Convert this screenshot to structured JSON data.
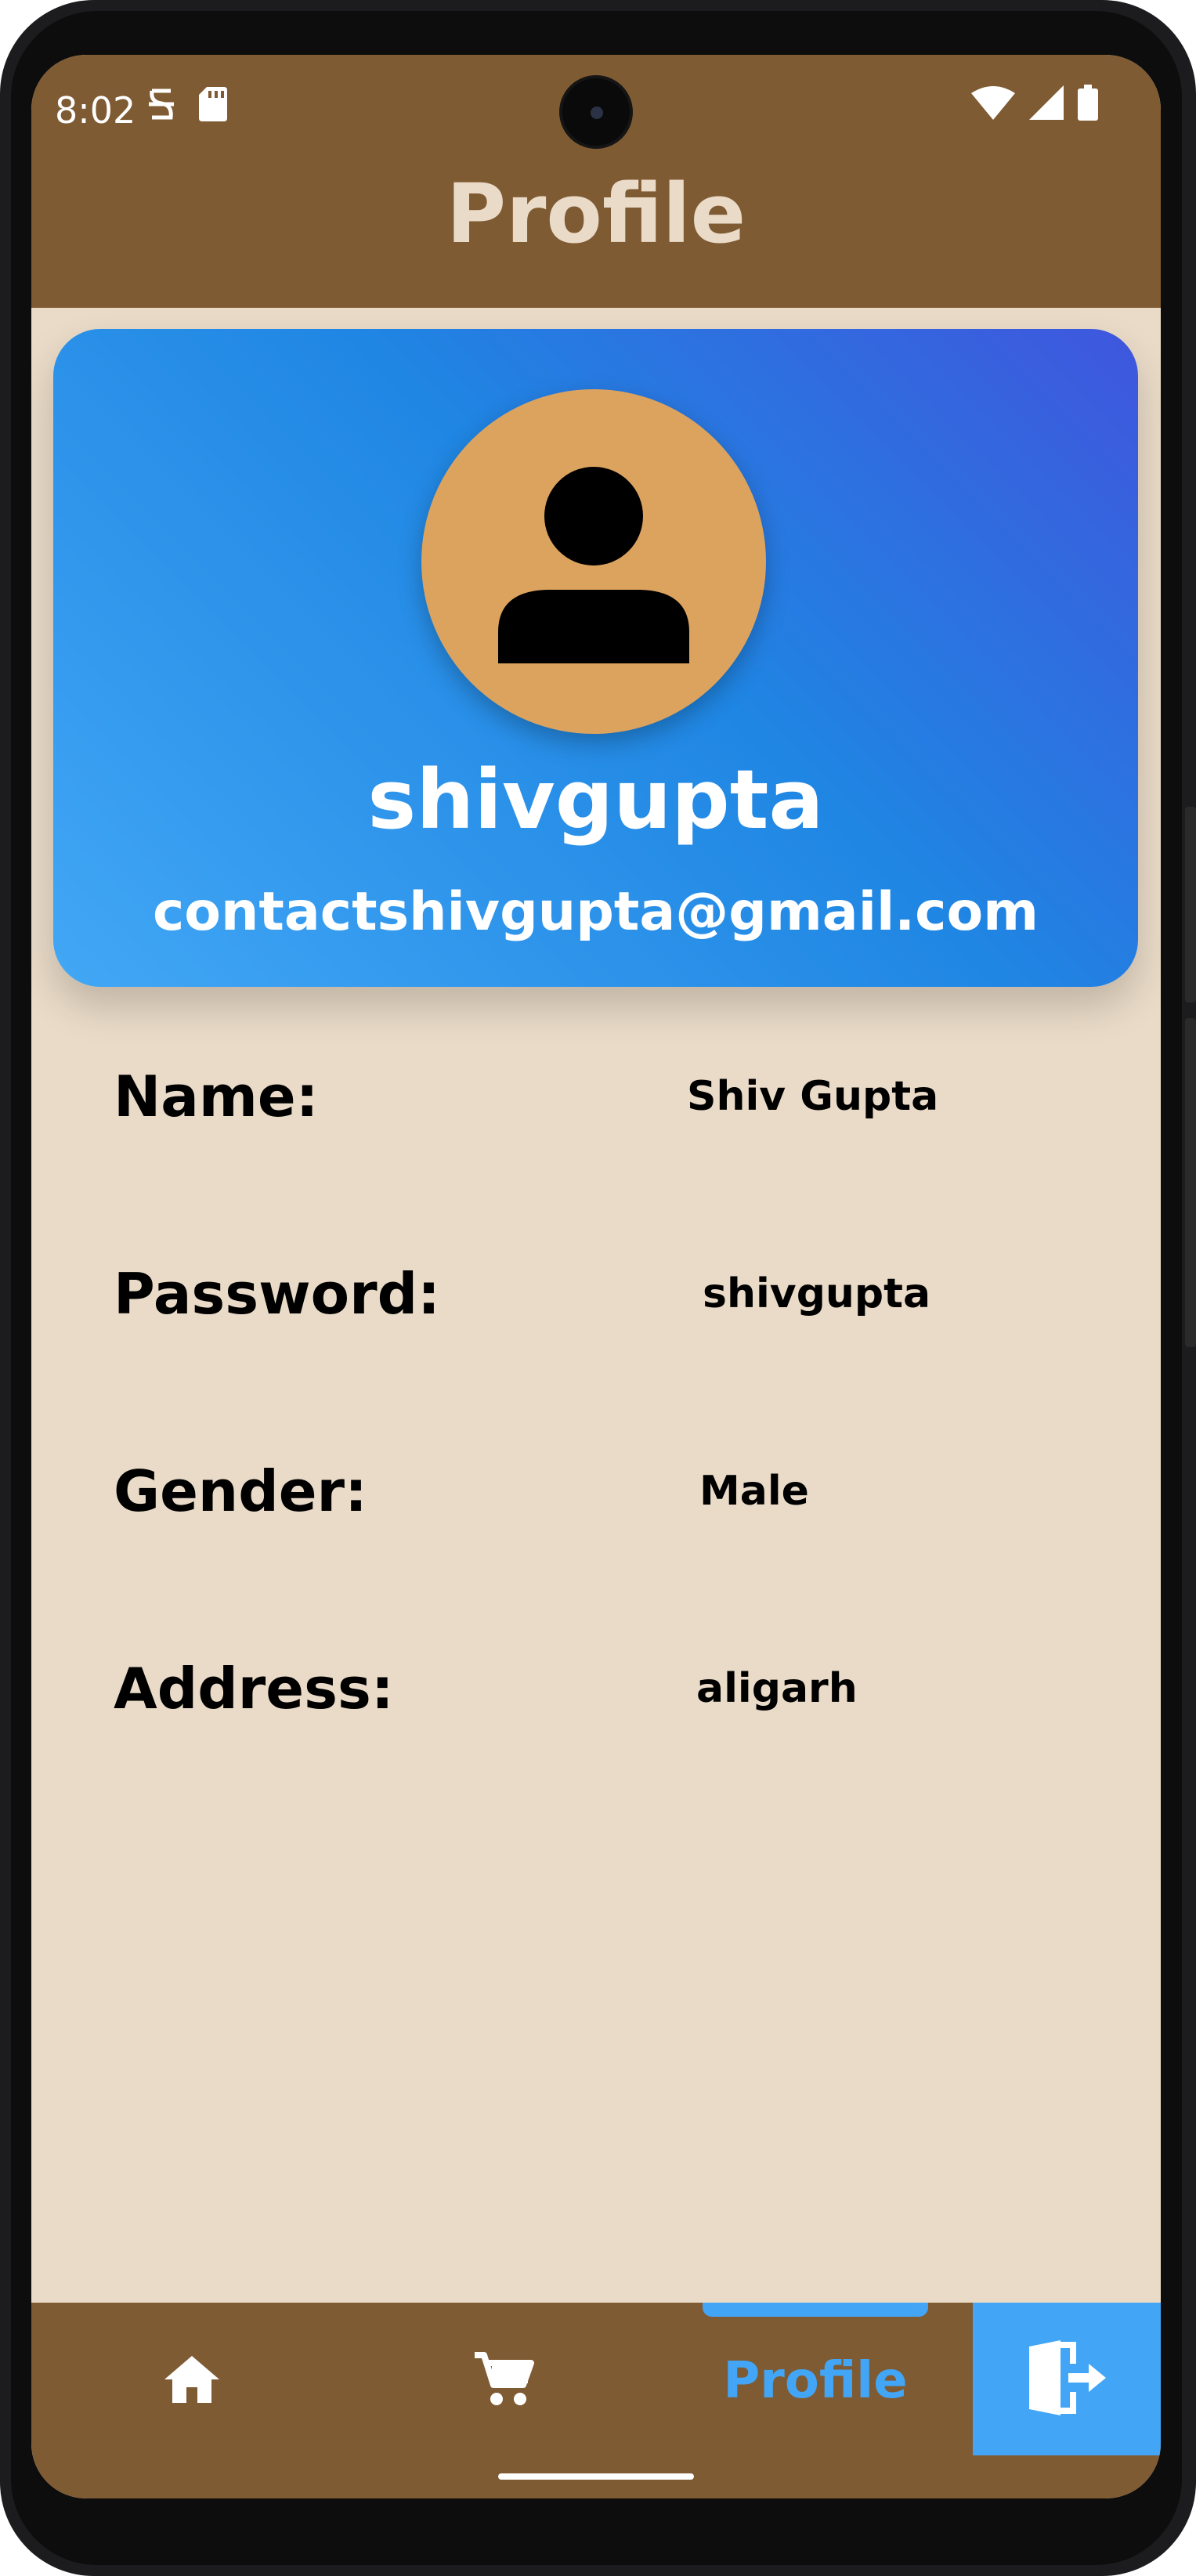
{
  "status_bar": {
    "time": "8:02"
  },
  "header": {
    "title": "Profile"
  },
  "profile": {
    "username": "shivgupta",
    "email": "contactshivgupta@gmail.com"
  },
  "details": [
    {
      "label": "Name:",
      "value": "Shiv Gupta"
    },
    {
      "label": "Password:",
      "value": "shivgupta"
    },
    {
      "label": "Gender:",
      "value": "Male"
    },
    {
      "label": "Address:",
      "value": "aligarh"
    }
  ],
  "nav": {
    "items": [
      "home-icon",
      "cart-icon",
      "Profile",
      "logout-icon"
    ],
    "active_label": "Profile"
  },
  "colors": {
    "header_bg": "#7f5b33",
    "page_bg": "#eadbc8",
    "accent": "#42a5f5",
    "avatar_bg": "#dca35f"
  }
}
